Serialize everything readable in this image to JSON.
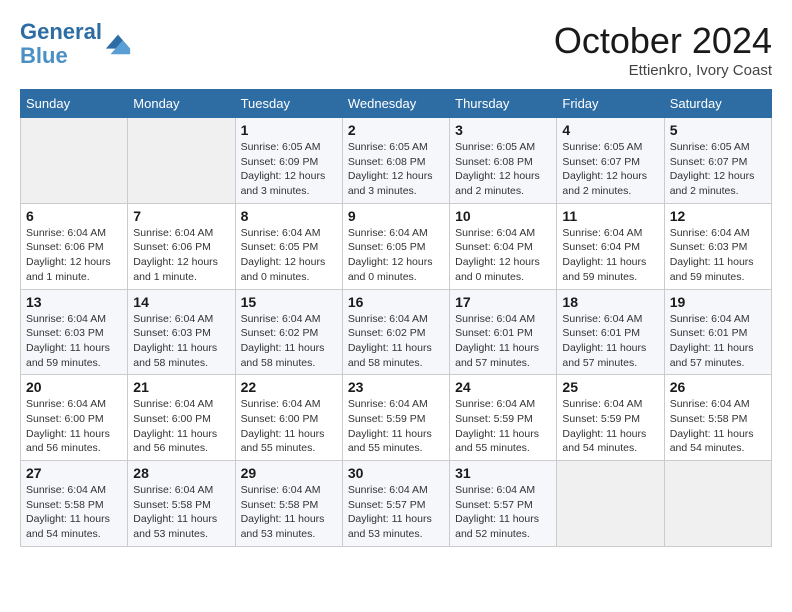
{
  "logo": {
    "line1": "General",
    "line2": "Blue"
  },
  "title": "October 2024",
  "location": "Ettienkro, Ivory Coast",
  "weekdays": [
    "Sunday",
    "Monday",
    "Tuesday",
    "Wednesday",
    "Thursday",
    "Friday",
    "Saturday"
  ],
  "weeks": [
    [
      {
        "day": "",
        "info": ""
      },
      {
        "day": "",
        "info": ""
      },
      {
        "day": "1",
        "info": "Sunrise: 6:05 AM\nSunset: 6:09 PM\nDaylight: 12 hours\nand 3 minutes."
      },
      {
        "day": "2",
        "info": "Sunrise: 6:05 AM\nSunset: 6:08 PM\nDaylight: 12 hours\nand 3 minutes."
      },
      {
        "day": "3",
        "info": "Sunrise: 6:05 AM\nSunset: 6:08 PM\nDaylight: 12 hours\nand 2 minutes."
      },
      {
        "day": "4",
        "info": "Sunrise: 6:05 AM\nSunset: 6:07 PM\nDaylight: 12 hours\nand 2 minutes."
      },
      {
        "day": "5",
        "info": "Sunrise: 6:05 AM\nSunset: 6:07 PM\nDaylight: 12 hours\nand 2 minutes."
      }
    ],
    [
      {
        "day": "6",
        "info": "Sunrise: 6:04 AM\nSunset: 6:06 PM\nDaylight: 12 hours\nand 1 minute."
      },
      {
        "day": "7",
        "info": "Sunrise: 6:04 AM\nSunset: 6:06 PM\nDaylight: 12 hours\nand 1 minute."
      },
      {
        "day": "8",
        "info": "Sunrise: 6:04 AM\nSunset: 6:05 PM\nDaylight: 12 hours\nand 0 minutes."
      },
      {
        "day": "9",
        "info": "Sunrise: 6:04 AM\nSunset: 6:05 PM\nDaylight: 12 hours\nand 0 minutes."
      },
      {
        "day": "10",
        "info": "Sunrise: 6:04 AM\nSunset: 6:04 PM\nDaylight: 12 hours\nand 0 minutes."
      },
      {
        "day": "11",
        "info": "Sunrise: 6:04 AM\nSunset: 6:04 PM\nDaylight: 11 hours\nand 59 minutes."
      },
      {
        "day": "12",
        "info": "Sunrise: 6:04 AM\nSunset: 6:03 PM\nDaylight: 11 hours\nand 59 minutes."
      }
    ],
    [
      {
        "day": "13",
        "info": "Sunrise: 6:04 AM\nSunset: 6:03 PM\nDaylight: 11 hours\nand 59 minutes."
      },
      {
        "day": "14",
        "info": "Sunrise: 6:04 AM\nSunset: 6:03 PM\nDaylight: 11 hours\nand 58 minutes."
      },
      {
        "day": "15",
        "info": "Sunrise: 6:04 AM\nSunset: 6:02 PM\nDaylight: 11 hours\nand 58 minutes."
      },
      {
        "day": "16",
        "info": "Sunrise: 6:04 AM\nSunset: 6:02 PM\nDaylight: 11 hours\nand 58 minutes."
      },
      {
        "day": "17",
        "info": "Sunrise: 6:04 AM\nSunset: 6:01 PM\nDaylight: 11 hours\nand 57 minutes."
      },
      {
        "day": "18",
        "info": "Sunrise: 6:04 AM\nSunset: 6:01 PM\nDaylight: 11 hours\nand 57 minutes."
      },
      {
        "day": "19",
        "info": "Sunrise: 6:04 AM\nSunset: 6:01 PM\nDaylight: 11 hours\nand 57 minutes."
      }
    ],
    [
      {
        "day": "20",
        "info": "Sunrise: 6:04 AM\nSunset: 6:00 PM\nDaylight: 11 hours\nand 56 minutes."
      },
      {
        "day": "21",
        "info": "Sunrise: 6:04 AM\nSunset: 6:00 PM\nDaylight: 11 hours\nand 56 minutes."
      },
      {
        "day": "22",
        "info": "Sunrise: 6:04 AM\nSunset: 6:00 PM\nDaylight: 11 hours\nand 55 minutes."
      },
      {
        "day": "23",
        "info": "Sunrise: 6:04 AM\nSunset: 5:59 PM\nDaylight: 11 hours\nand 55 minutes."
      },
      {
        "day": "24",
        "info": "Sunrise: 6:04 AM\nSunset: 5:59 PM\nDaylight: 11 hours\nand 55 minutes."
      },
      {
        "day": "25",
        "info": "Sunrise: 6:04 AM\nSunset: 5:59 PM\nDaylight: 11 hours\nand 54 minutes."
      },
      {
        "day": "26",
        "info": "Sunrise: 6:04 AM\nSunset: 5:58 PM\nDaylight: 11 hours\nand 54 minutes."
      }
    ],
    [
      {
        "day": "27",
        "info": "Sunrise: 6:04 AM\nSunset: 5:58 PM\nDaylight: 11 hours\nand 54 minutes."
      },
      {
        "day": "28",
        "info": "Sunrise: 6:04 AM\nSunset: 5:58 PM\nDaylight: 11 hours\nand 53 minutes."
      },
      {
        "day": "29",
        "info": "Sunrise: 6:04 AM\nSunset: 5:58 PM\nDaylight: 11 hours\nand 53 minutes."
      },
      {
        "day": "30",
        "info": "Sunrise: 6:04 AM\nSunset: 5:57 PM\nDaylight: 11 hours\nand 53 minutes."
      },
      {
        "day": "31",
        "info": "Sunrise: 6:04 AM\nSunset: 5:57 PM\nDaylight: 11 hours\nand 52 minutes."
      },
      {
        "day": "",
        "info": ""
      },
      {
        "day": "",
        "info": ""
      }
    ]
  ]
}
